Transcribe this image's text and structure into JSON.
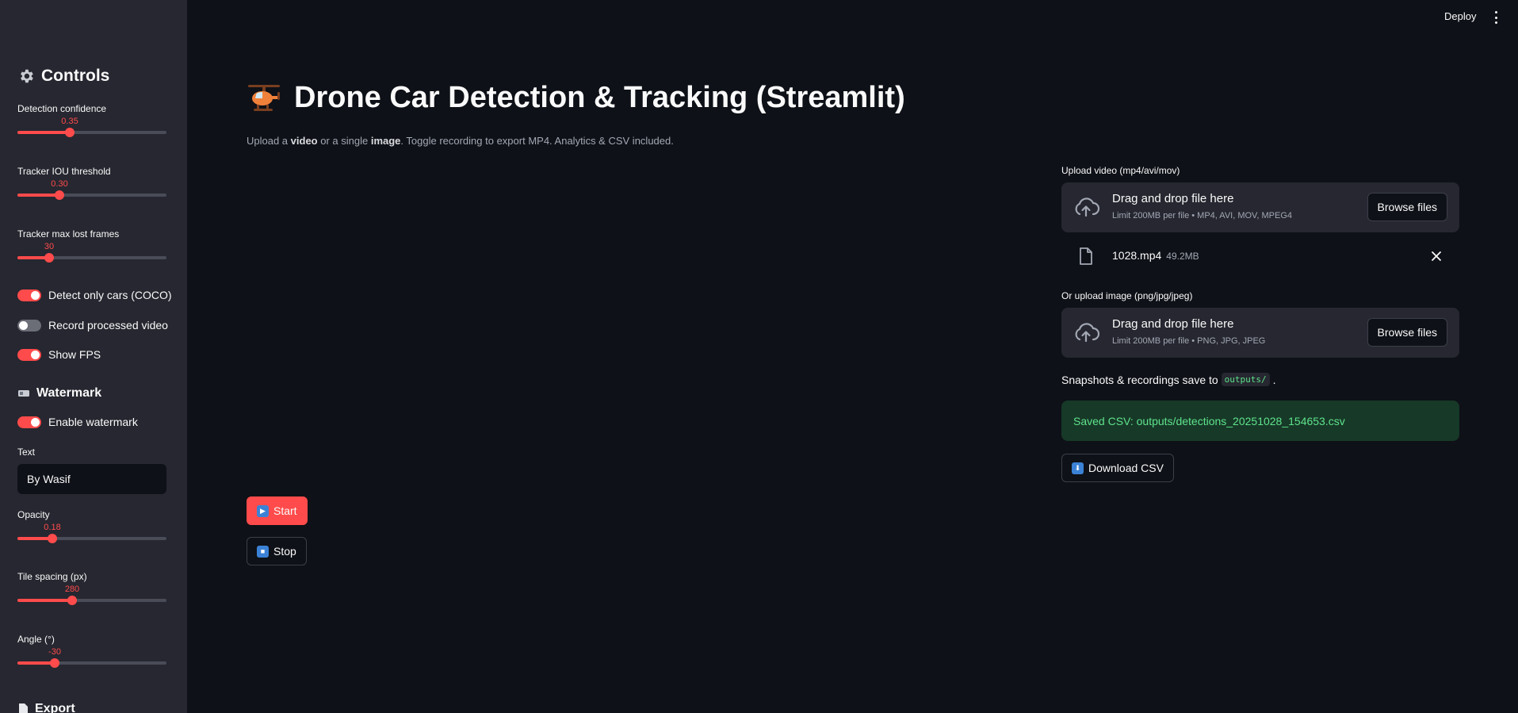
{
  "header": {
    "deploy_label": "Deploy"
  },
  "sidebar": {
    "controls_title": "Controls",
    "watermark_title": "Watermark",
    "export_title": "Export",
    "sliders": [
      {
        "label": "Detection confidence",
        "value": "0.35",
        "fraction": 0.35
      },
      {
        "label": "Tracker IOU threshold",
        "value": "0.30",
        "fraction": 0.28
      },
      {
        "label": "Tracker max lost frames",
        "value": "30",
        "fraction": 0.21
      }
    ],
    "toggles": [
      {
        "label": "Detect only cars (COCO)",
        "on": true
      },
      {
        "label": "Record processed video",
        "on": false
      },
      {
        "label": "Show FPS",
        "on": true
      }
    ],
    "watermark_toggle": {
      "label": "Enable watermark",
      "on": true
    },
    "text_label": "Text",
    "text_value": "By Wasif",
    "wm_sliders": [
      {
        "label": "Opacity",
        "value": "0.18",
        "fraction": 0.23
      },
      {
        "label": "Tile spacing (px)",
        "value": "280",
        "fraction": 0.37
      },
      {
        "label": "Angle (°)",
        "value": "-30",
        "fraction": 0.25
      }
    ]
  },
  "main": {
    "title": "Drone Car Detection & Tracking (Streamlit)",
    "subtitle": {
      "p1": "Upload a ",
      "b1": "video",
      "p2": " or a single ",
      "b2": "image",
      "p3": ". Toggle recording to export MP4. Analytics & CSV included."
    },
    "start_label": "Start",
    "stop_label": "Stop"
  },
  "video_uploader": {
    "label": "Upload video (mp4/avi/mov)",
    "drop_title": "Drag and drop file here",
    "drop_sub": "Limit 200MB per file • MP4, AVI, MOV, MPEG4",
    "browse": "Browse files",
    "file_name": "1028.mp4",
    "file_size": "49.2MB"
  },
  "image_uploader": {
    "label": "Or upload image (png/jpg/jpeg)",
    "drop_title": "Drag and drop file here",
    "drop_sub": "Limit 200MB per file • PNG, JPG, JPEG",
    "browse": "Browse files"
  },
  "snapshots": {
    "text": "Snapshots & recordings save to",
    "code": "outputs/",
    "suffix": "."
  },
  "success_message": "Saved CSV: outputs/detections_20251028_154653.csv",
  "download_label": "Download CSV",
  "colors": {
    "accent": "#ff4b4b",
    "background": "#0e1117",
    "sidebar": "#262730",
    "success_text": "#5ee38b"
  }
}
